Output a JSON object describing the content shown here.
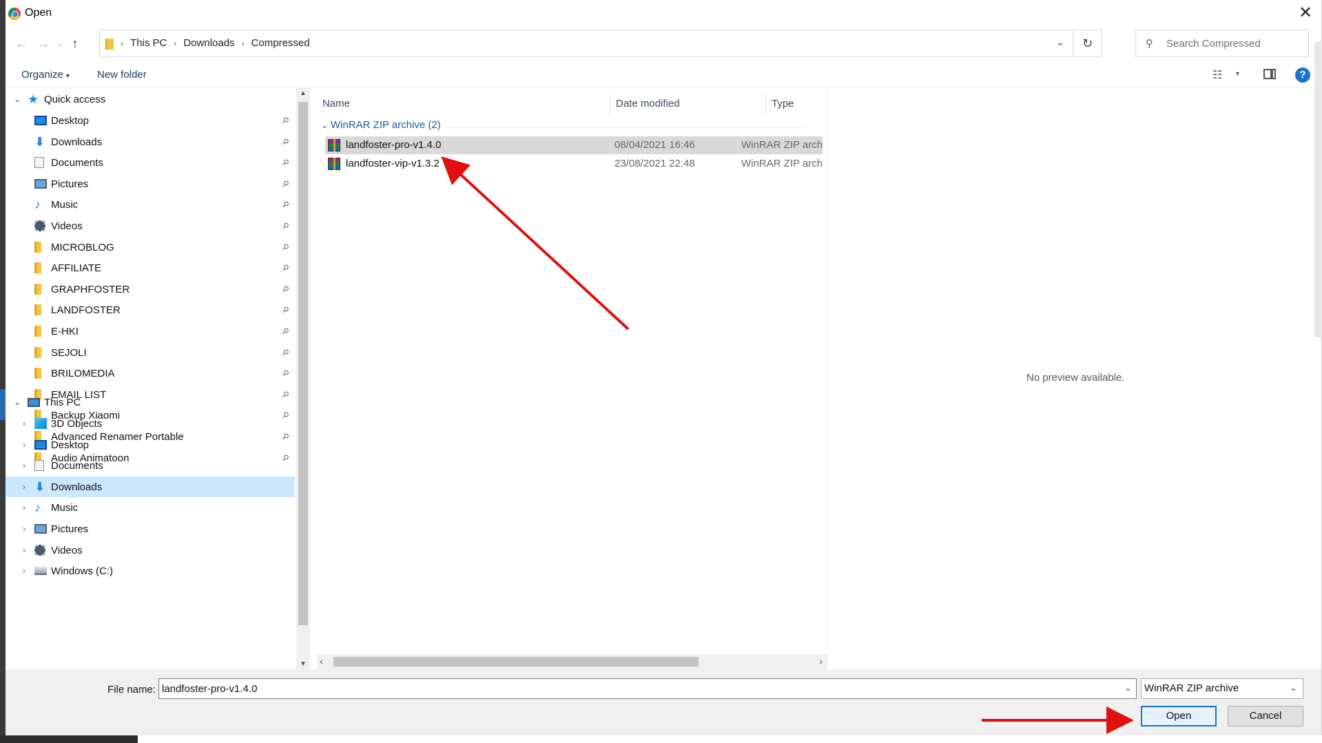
{
  "window": {
    "title": "Open",
    "close_glyph": "✕"
  },
  "nav": {
    "back_glyph": "←",
    "forward_glyph": "→",
    "recent_glyph": "⌄",
    "up_glyph": "↑",
    "breadcrumbs": [
      "This PC",
      "Downloads",
      "Compressed"
    ],
    "crumb_sep": "›",
    "dropdown_glyph": "⌄",
    "refresh_glyph": "↻"
  },
  "search": {
    "placeholder": "Search Compressed",
    "icon_glyph": "⚲"
  },
  "toolbar": {
    "organize_label": "Organize",
    "organize_caret": "▾",
    "new_folder_label": "New folder",
    "view_glyph": "☷",
    "view_caret": "▾",
    "help_glyph": "?"
  },
  "tree": {
    "quick_access": {
      "label": "Quick access",
      "items": [
        {
          "label": "Desktop",
          "icon": "desktop-icon"
        },
        {
          "label": "Downloads",
          "icon": "downloads-icon"
        },
        {
          "label": "Documents",
          "icon": "documents-icon"
        },
        {
          "label": "Pictures",
          "icon": "pictures-icon"
        },
        {
          "label": "Music",
          "icon": "music-icon"
        },
        {
          "label": "Videos",
          "icon": "videos-icon"
        },
        {
          "label": "MICROBLOG",
          "icon": "folder-icon"
        },
        {
          "label": "AFFILIATE",
          "icon": "folder-icon"
        },
        {
          "label": "GRAPHFOSTER",
          "icon": "folder-icon"
        },
        {
          "label": "LANDFOSTER",
          "icon": "folder-icon"
        },
        {
          "label": "E-HKI",
          "icon": "folder-icon"
        },
        {
          "label": "SEJOLI",
          "icon": "folder-icon"
        },
        {
          "label": "BRILOMEDIA",
          "icon": "folder-icon"
        },
        {
          "label": "EMAIL LIST",
          "icon": "folder-icon"
        },
        {
          "label": "Backup Xiaomi",
          "icon": "folder-icon"
        },
        {
          "label": "Advanced Renamer Portable",
          "icon": "folder-icon"
        },
        {
          "label": "Audio Animatoon",
          "icon": "folder-icon"
        }
      ]
    },
    "this_pc": {
      "label": "This PC",
      "items": [
        {
          "label": "3D Objects",
          "icon": "3d-objects-icon"
        },
        {
          "label": "Desktop",
          "icon": "desktop-icon"
        },
        {
          "label": "Documents",
          "icon": "documents-icon"
        },
        {
          "label": "Downloads",
          "icon": "downloads-icon",
          "selected": true
        },
        {
          "label": "Music",
          "icon": "music-icon"
        },
        {
          "label": "Pictures",
          "icon": "pictures-icon"
        },
        {
          "label": "Videos",
          "icon": "videos-icon"
        },
        {
          "label": "Windows (C:)",
          "icon": "drive-icon"
        }
      ]
    },
    "expanded_glyph": "⌄",
    "collapsed_glyph": "›",
    "pin_glyph": "📌"
  },
  "file_list": {
    "columns": [
      "Name",
      "Date modified",
      "Type"
    ],
    "group_label": "WinRAR ZIP archive (2)",
    "group_chevron": "⌄",
    "files": [
      {
        "name": "landfoster-pro-v1.4.0",
        "date": "08/04/2021 16:46",
        "type": "WinRAR ZIP archive",
        "selected": true
      },
      {
        "name": "landfoster-vip-v1.3.2",
        "date": "23/08/2021 22:48",
        "type": "WinRAR ZIP archive",
        "selected": false
      }
    ]
  },
  "preview": {
    "text": "No preview available."
  },
  "bottom": {
    "file_name_label": "File name:",
    "file_name_value": "landfoster-pro-v1.4.0",
    "file_type_value": "WinRAR ZIP archive",
    "dropdown_glyph": "⌄",
    "open_label": "Open",
    "cancel_label": "Cancel"
  },
  "colors": {
    "accent": "#1a73c8",
    "selection": "#cce8ff",
    "annotation_arrow": "#e01010"
  }
}
